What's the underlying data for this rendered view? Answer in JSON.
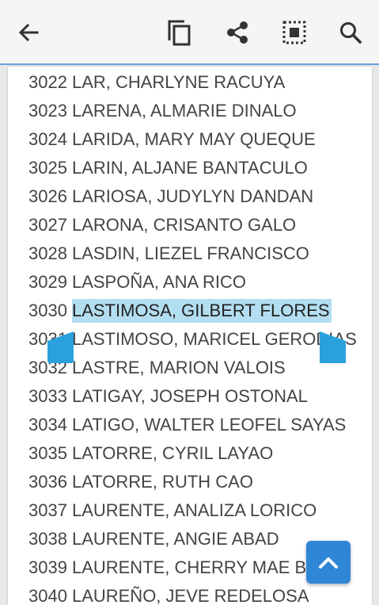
{
  "toolbar": {
    "icons": [
      "back-arrow-icon",
      "copy-icon",
      "share-icon",
      "select-all-icon",
      "search-icon"
    ]
  },
  "list": [
    {
      "num": "3022",
      "name": "LAR, CHARLYNE RACUYA"
    },
    {
      "num": "3023",
      "name": "LARENA, ALMARIE DINALO"
    },
    {
      "num": "3024",
      "name": "LARIDA, MARY MAY QUEQUE"
    },
    {
      "num": "3025",
      "name": "LARIN, ALJANE BANTACULO"
    },
    {
      "num": "3026",
      "name": "LARIOSA, JUDYLYN DANDAN"
    },
    {
      "num": "3027",
      "name": "LARONA, CRISANTO GALO"
    },
    {
      "num": "3028",
      "name": "LASDIN, LIEZEL FRANCISCO"
    },
    {
      "num": "3029",
      "name": "LASPOÑA, ANA RICO"
    },
    {
      "num": "3030",
      "name": "LASTIMOSA, GILBERT FLORES"
    },
    {
      "num": "3031",
      "name": "LASTIMOSO, MARICEL GERODIAS"
    },
    {
      "num": "3032",
      "name": "LASTRE, MARION VALOIS"
    },
    {
      "num": "3033",
      "name": "LATIGAY, JOSEPH OSTONAL"
    },
    {
      "num": "3034",
      "name": "LATIGO, WALTER LEOFEL SAYAS"
    },
    {
      "num": "3035",
      "name": "LATORRE, CYRIL LAYAO"
    },
    {
      "num": "3036",
      "name": "LATORRE, RUTH CAO"
    },
    {
      "num": "3037",
      "name": "LAURENTE, ANALIZA LORICO"
    },
    {
      "num": "3038",
      "name": "LAURENTE, ANGIE ABAD"
    },
    {
      "num": "3039",
      "name": "LAURENTE, CHERRY MAE BA"
    },
    {
      "num": "3040",
      "name": "LAUREÑO, JEVE REDELOSA"
    }
  ],
  "selection": {
    "text": "LASTIMOSA, GILBERT FLORES",
    "color": "#b3def1"
  },
  "accent": "#2aa0dd"
}
